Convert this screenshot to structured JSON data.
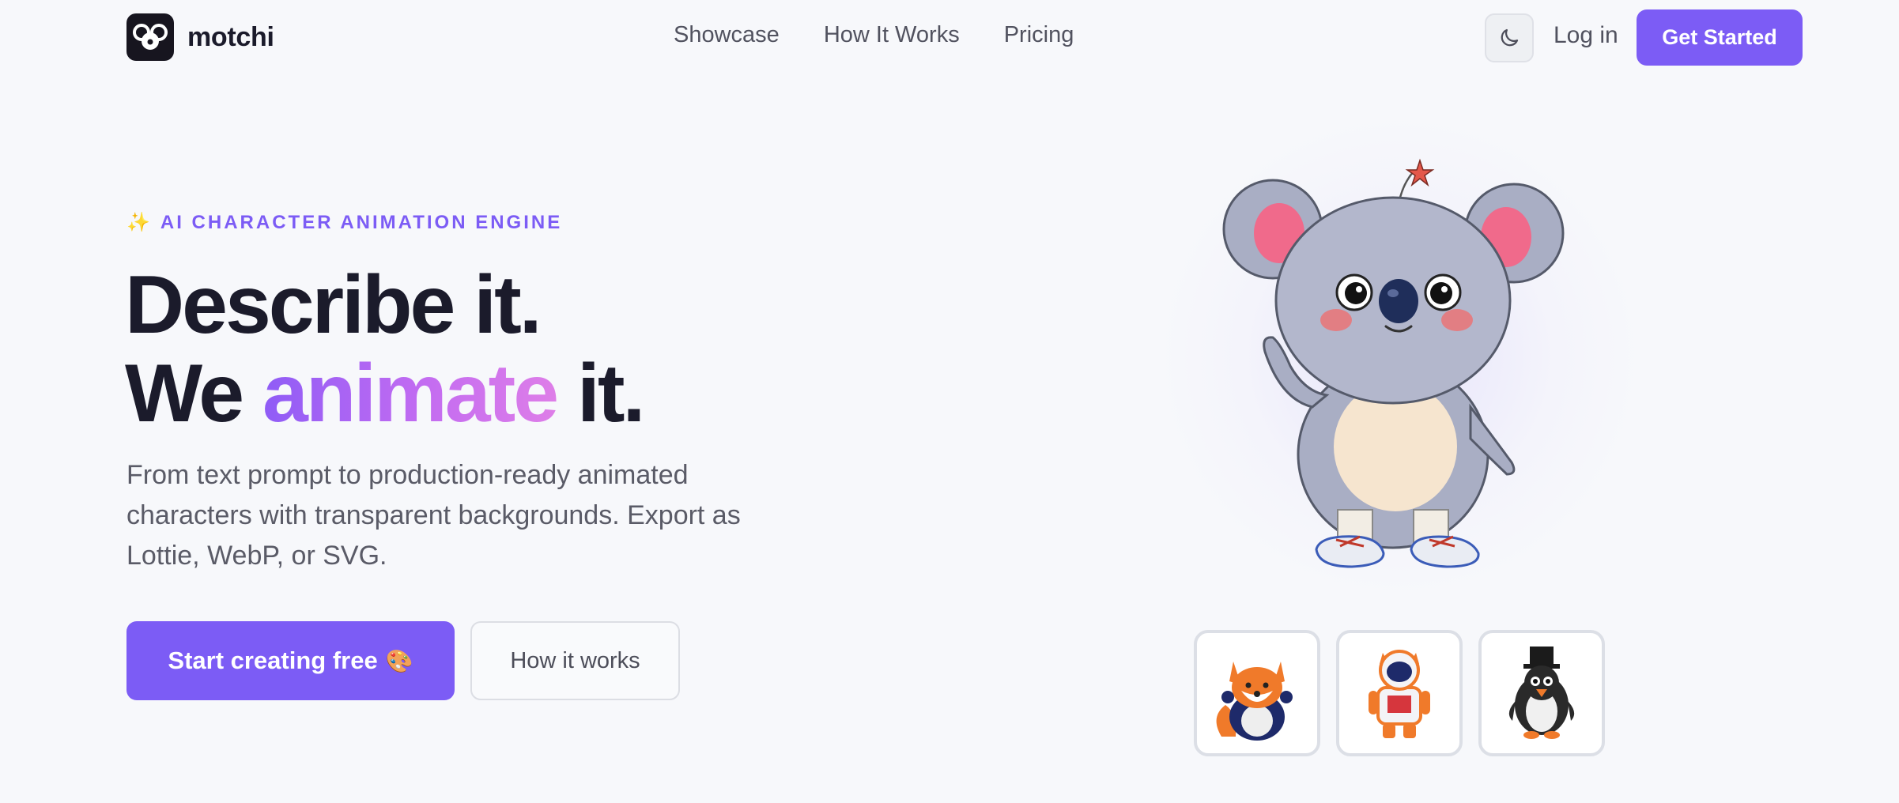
{
  "nav": {
    "brand": "motchi",
    "links": [
      "Showcase",
      "How It Works",
      "Pricing"
    ],
    "login": "Log in",
    "cta": "Get Started",
    "theme_icon": "moon-icon"
  },
  "hero": {
    "eyebrow": "AI CHARACTER ANIMATION ENGINE",
    "eyebrow_icon": "sparkles-icon",
    "headline_line1": "Describe it.",
    "headline_line2_pre": "We ",
    "headline_line2_highlight": "animate",
    "headline_line2_post": " it.",
    "subtext": "From text prompt to production-ready animated characters with transparent backgrounds. Export as Lottie, WebP, or SVG.",
    "primary_cta": "Start creating free",
    "primary_cta_icon": "palette-icon",
    "secondary_cta": "How it works"
  },
  "showcase": {
    "featured": "koala-character",
    "thumbnails": [
      "fox-character",
      "astronaut-cat-character",
      "penguin-top-hat-character"
    ]
  },
  "colors": {
    "accent": "#7c5cf5",
    "background": "#f7f8fb",
    "text": "#1b1b2b",
    "muted": "#5a5b67",
    "gradient_start": "#8f5cf6",
    "gradient_end": "#de7ee8"
  }
}
